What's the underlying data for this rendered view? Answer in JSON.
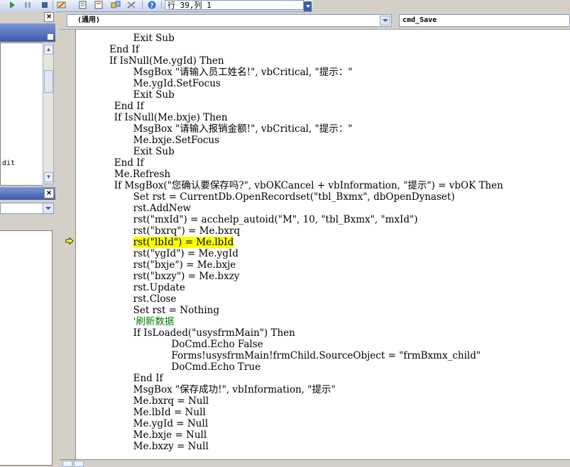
{
  "toolbar": {
    "position_text": "行 39,列 1"
  },
  "left_pane": {
    "list_item": "dit"
  },
  "code_window": {
    "object_combo": "(通用)",
    "procedure_combo": "cmd_Save",
    "lines": [
      {
        "indent": 12,
        "text": "Exit Sub"
      },
      {
        "indent": 7,
        "text": "End If"
      },
      {
        "indent": 7,
        "text": "If IsNull(Me.ygId) Then"
      },
      {
        "indent": 12,
        "text": "MsgBox \"请输入员工姓名!\", vbCritical, \"提示：\""
      },
      {
        "indent": 12,
        "text": "Me.ygId.SetFocus"
      },
      {
        "indent": 12,
        "text": "Exit Sub"
      },
      {
        "indent": 8,
        "text": "End If"
      },
      {
        "indent": 8,
        "text": "If IsNull(Me.bxje) Then"
      },
      {
        "indent": 12,
        "text": "MsgBox \"请输入报销金额!\", vbCritical, \"提示：\""
      },
      {
        "indent": 12,
        "text": "Me.bxje.SetFocus"
      },
      {
        "indent": 12,
        "text": "Exit Sub"
      },
      {
        "indent": 8,
        "text": "End If"
      },
      {
        "indent": 8,
        "text": "Me.Refresh"
      },
      {
        "indent": 8,
        "text": "If MsgBox(\"您确认要保存吗?\", vbOKCancel + vbInformation, \"提示\") = vbOK Then"
      },
      {
        "indent": 12,
        "text": "Set rst = CurrentDb.OpenRecordset(\"tbl_Bxmx\", dbOpenDynaset)"
      },
      {
        "indent": 12,
        "text": "rst.AddNew"
      },
      {
        "indent": 12,
        "text": "rst(\"mxId\") = acchelp_autoid(\"M\", 10, \"tbl_Bxmx\", \"mxId\")"
      },
      {
        "indent": 12,
        "text": "rst(\"bxrq\") = Me.bxrq"
      },
      {
        "indent": 12,
        "text": "rst(\"lbId\") = Me.lbId",
        "highlight": true
      },
      {
        "indent": 12,
        "text": "rst(\"ygId\") = Me.ygId"
      },
      {
        "indent": 12,
        "text": "rst(\"bxje\") = Me.bxje"
      },
      {
        "indent": 12,
        "text": "rst(\"bxzy\") = Me.bxzy"
      },
      {
        "indent": 12,
        "text": "rst.Update"
      },
      {
        "indent": 12,
        "text": "rst.Close"
      },
      {
        "indent": 12,
        "text": "Set rst = Nothing"
      },
      {
        "indent": 12,
        "text": "'刷新数据",
        "comment": true
      },
      {
        "indent": 12,
        "text": "If IsLoaded(\"usysfrmMain\") Then"
      },
      {
        "indent": 20,
        "text": "DoCmd.Echo False"
      },
      {
        "indent": 20,
        "text": "Forms!usysfrmMain!frmChild.SourceObject = \"frmBxmx_child\""
      },
      {
        "indent": 20,
        "text": "DoCmd.Echo True"
      },
      {
        "indent": 12,
        "text": "End If"
      },
      {
        "indent": 12,
        "text": "MsgBox \"保存成功!\", vbInformation, \"提示\""
      },
      {
        "indent": 12,
        "text": "Me.bxrq = Null"
      },
      {
        "indent": 12,
        "text": "Me.lbId = Null"
      },
      {
        "indent": 12,
        "text": "Me.ygId = Null"
      },
      {
        "indent": 12,
        "text": "Me.bxje = Null"
      },
      {
        "indent": 12,
        "text": "Me.bxzy = Null"
      }
    ]
  },
  "colors": {
    "highlight": "#ffff00",
    "comment": "#008000",
    "toolbar_accent": "#3c5ba8"
  }
}
